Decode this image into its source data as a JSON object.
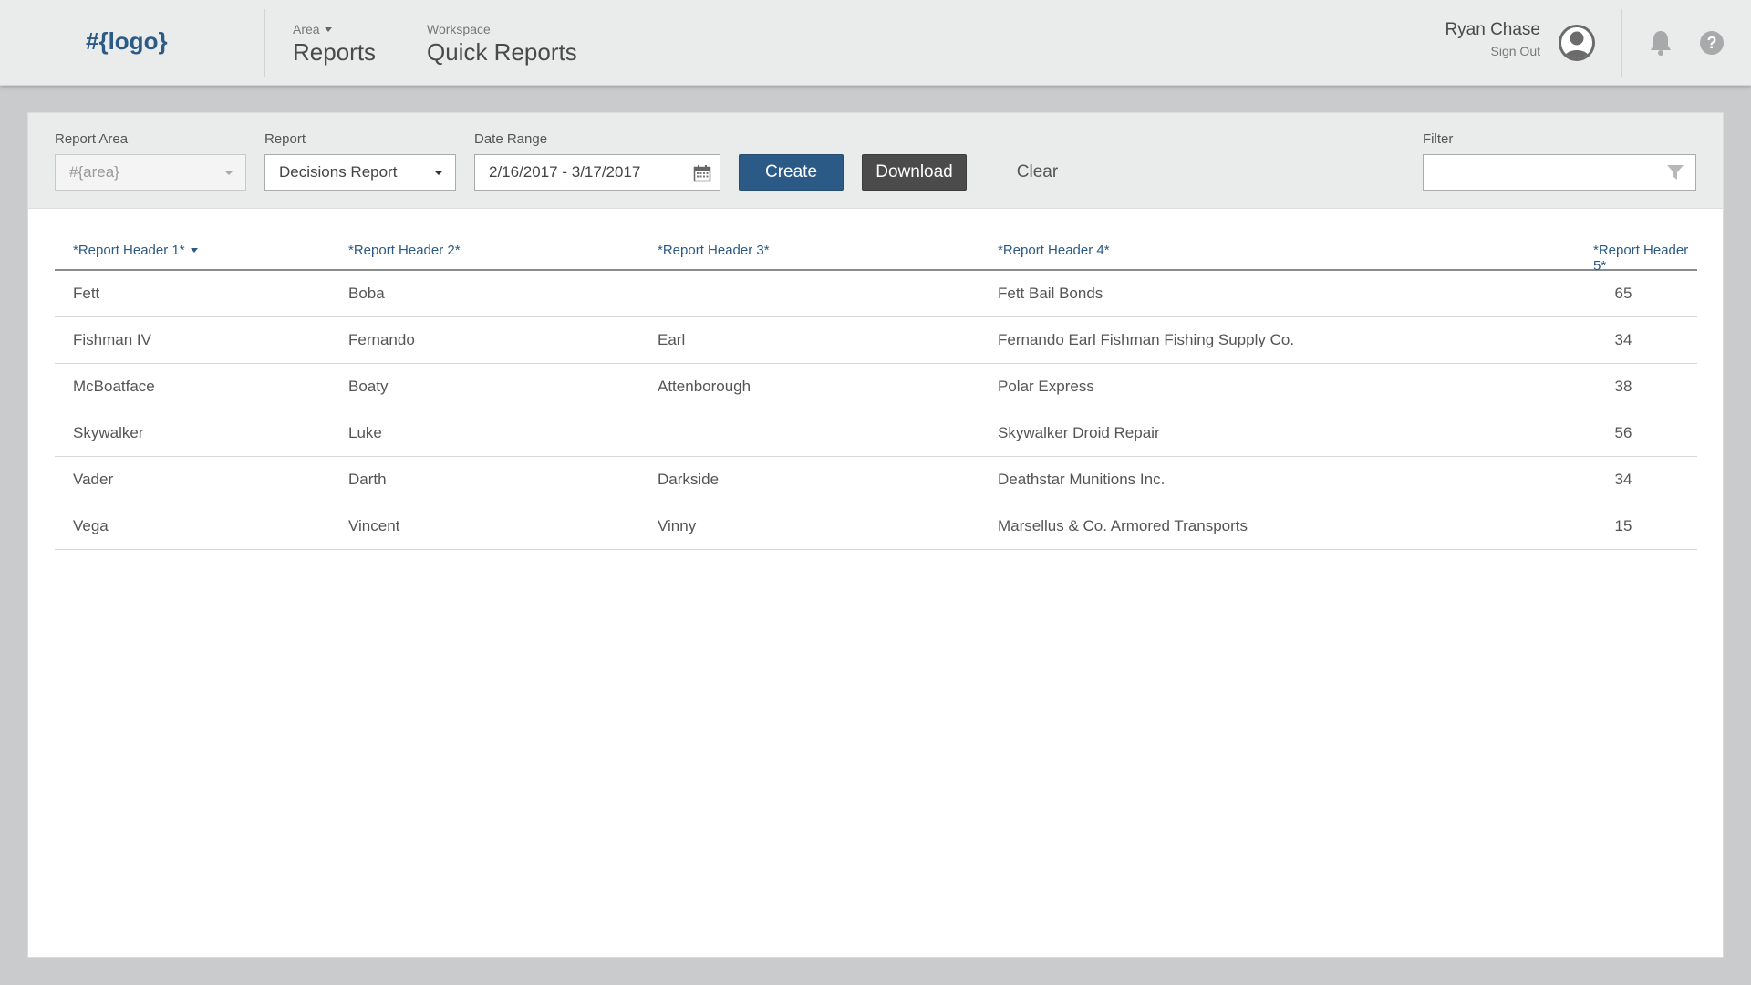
{
  "header": {
    "logo": "#{logo}",
    "area_label": "Area",
    "area_value": "Reports",
    "workspace_label": "Workspace",
    "workspace_value": "Quick Reports",
    "user_name": "Ryan Chase",
    "sign_out": "Sign Out",
    "icons": [
      "avatar-icon",
      "bell-icon",
      "help-icon"
    ],
    "help_glyph": "?"
  },
  "toolbar": {
    "report_area_label": "Report Area",
    "report_area_value": "#{area}",
    "report_label": "Report",
    "report_value": "Decisions Report",
    "date_range_label": "Date Range",
    "date_range_value": "2/16/2017 - 3/17/2017",
    "create_label": "Create",
    "download_label": "Download",
    "clear_label": "Clear",
    "filter_label": "Filter",
    "filter_value": ""
  },
  "table": {
    "headers": [
      "*Report Header 1*",
      "*Report Header 2*",
      "*Report Header 3*",
      "*Report Header 4*",
      "*Report Header 5*"
    ],
    "rows": [
      [
        "Fett",
        "Boba",
        "",
        "Fett Bail Bonds",
        "65"
      ],
      [
        "Fishman IV",
        "Fernando",
        "Earl",
        "Fernando Earl Fishman Fishing Supply Co.",
        "34"
      ],
      [
        "McBoatface",
        "Boaty",
        "Attenborough",
        "Polar Express",
        "38"
      ],
      [
        "Skywalker",
        "Luke",
        "",
        "Skywalker Droid Repair",
        "56"
      ],
      [
        "Vader",
        "Darth",
        "Darkside",
        "Deathstar Munitions Inc.",
        "34"
      ],
      [
        "Vega",
        "Vincent",
        "Vinny",
        "Marsellus & Co. Armored Transports",
        "15"
      ]
    ]
  },
  "colors": {
    "accent": "#2b5a86",
    "download": "#4b4b4b",
    "page_bg": "#c9cbcc",
    "bar_bg": "#eaebeb"
  }
}
